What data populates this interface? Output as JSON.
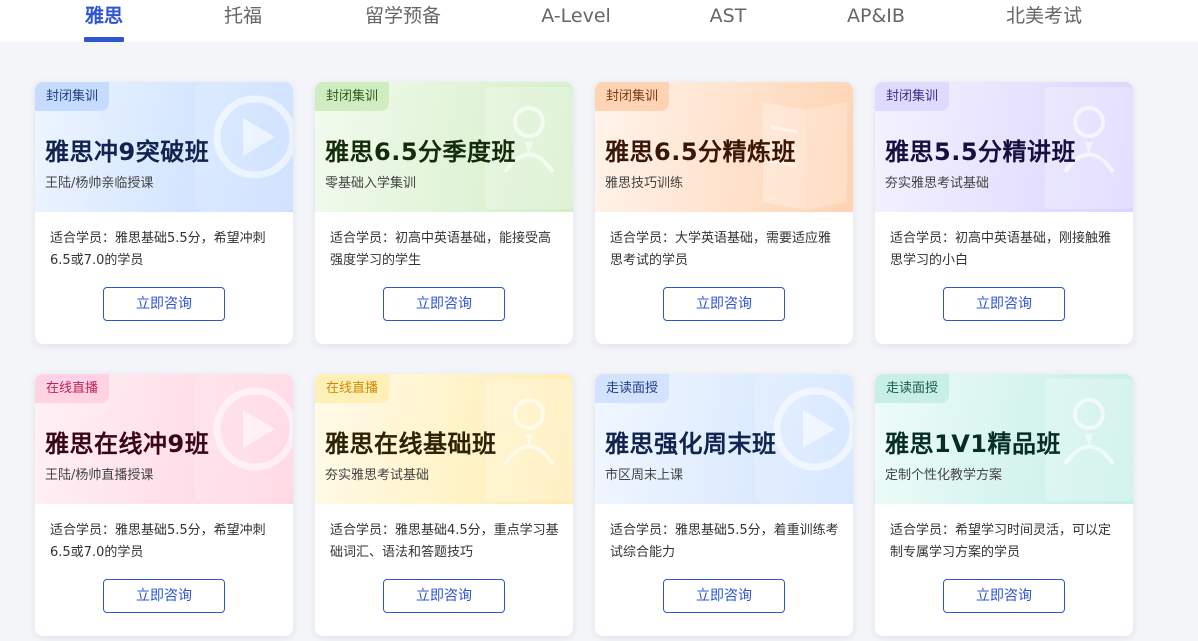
{
  "tabs": [
    {
      "label": "雅思",
      "active": true
    },
    {
      "label": "托福",
      "active": false
    },
    {
      "label": "留学预备",
      "active": false
    },
    {
      "label": "A-Level",
      "active": false
    },
    {
      "label": "AST",
      "active": false
    },
    {
      "label": "AP&IB",
      "active": false
    },
    {
      "label": "北美考试",
      "active": false
    }
  ],
  "accent_color": "#2f55d4",
  "courses": [
    {
      "tag": "封闭集训",
      "title": "雅思冲9突破班",
      "subtitle": "王陆/杨帅亲临授课",
      "desc": "适合学员：雅思基础5.5分，希望冲刺6.5或7.0的学员",
      "button": "立即咨询",
      "icon": "play-icon",
      "theme": "blue"
    },
    {
      "tag": "封闭集训",
      "title": "雅思6.5分季度班",
      "subtitle": "零基础入学集训",
      "desc": "适合学员：初高中英语基础，能接受高强度学习的学生",
      "button": "立即咨询",
      "icon": "teacher-icon",
      "theme": "green"
    },
    {
      "tag": "封闭集训",
      "title": "雅思6.5分精炼班",
      "subtitle": "雅思技巧训练",
      "desc": "适合学员：大学英语基础，需要适应雅思考试的学员",
      "button": "立即咨询",
      "icon": "book-icon",
      "theme": "orange"
    },
    {
      "tag": "封闭集训",
      "title": "雅思5.5分精讲班",
      "subtitle": "夯实雅思考试基础",
      "desc": "适合学员：初高中英语基础，刚接触雅思学习的小白",
      "button": "立即咨询",
      "icon": "teacher-icon",
      "theme": "purple"
    },
    {
      "tag": "在线直播",
      "title": "雅思在线冲9班",
      "subtitle": "王陆/杨帅直播授课",
      "desc": "适合学员：雅思基础5.5分，希望冲刺6.5或7.0的学员",
      "button": "立即咨询",
      "icon": "play-icon",
      "theme": "pink"
    },
    {
      "tag": "在线直播",
      "title": "雅思在线基础班",
      "subtitle": "夯实雅思考试基础",
      "desc": "适合学员：雅思基础4.5分，重点学习基础词汇、语法和答题技巧",
      "button": "立即咨询",
      "icon": "teacher-icon",
      "theme": "yellow"
    },
    {
      "tag": "走读面授",
      "title": "雅思强化周末班",
      "subtitle": "市区周末上课",
      "desc": "适合学员：雅思基础5.5分，着重训练考试综合能力",
      "button": "立即咨询",
      "icon": "play-icon",
      "theme": "sky"
    },
    {
      "tag": "走读面授",
      "title": "雅思1V1精品班",
      "subtitle": "定制个性化教学方案",
      "desc": "适合学员：希望学习时间灵活，可以定制专属学习方案的学员",
      "button": "立即咨询",
      "icon": "teacher-icon",
      "theme": "teal"
    }
  ]
}
